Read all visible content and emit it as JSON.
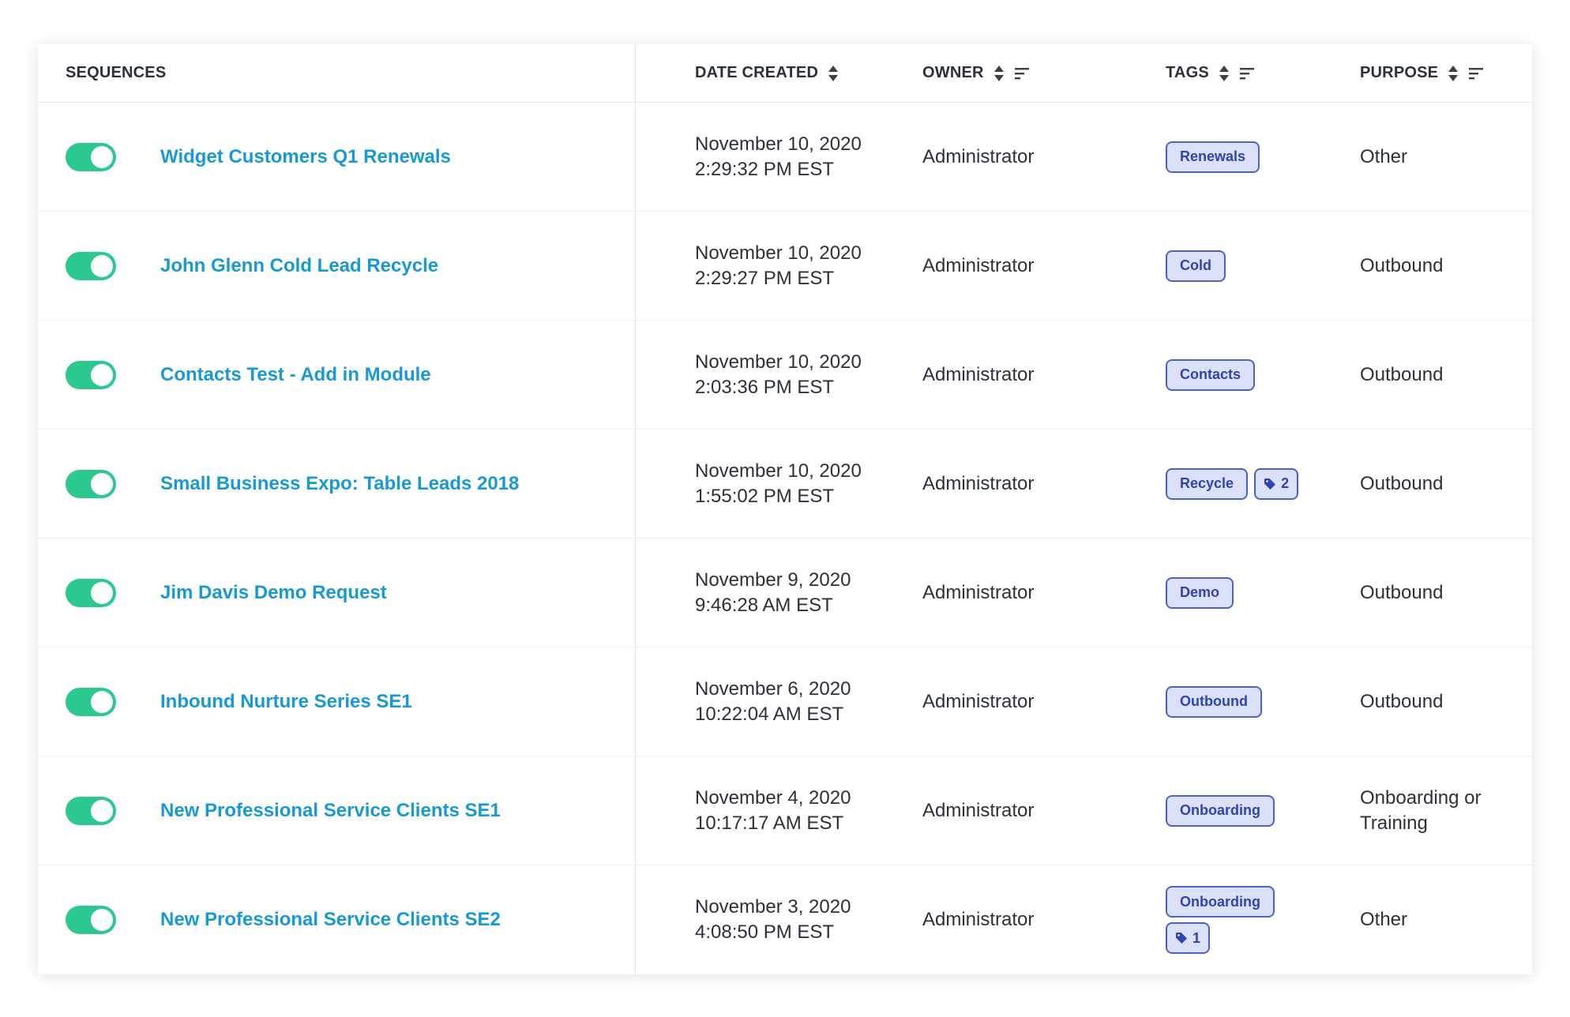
{
  "header": {
    "sequences": "SEQUENCES",
    "date_created": "DATE CREATED",
    "owner": "OWNER",
    "tags": "TAGS",
    "purpose": "PURPOSE"
  },
  "colors": {
    "toggle_on": "#2bc98e",
    "link": "#1899d6",
    "tag_bg": "#dbe1fb",
    "tag_border": "#4b62c8",
    "text": "#2b3138"
  },
  "rows": [
    {
      "enabled": true,
      "name": "Widget Customers Q1 Renewals",
      "date": "November 10, 2020",
      "time": "2:29:32 PM EST",
      "owner": "Administrator",
      "tags": [
        "Renewals"
      ],
      "extra_tags": null,
      "purpose": "Other"
    },
    {
      "enabled": true,
      "name": "John Glenn Cold Lead Recycle",
      "date": "November 10, 2020",
      "time": "2:29:27 PM EST",
      "owner": "Administrator",
      "tags": [
        "Cold"
      ],
      "extra_tags": null,
      "purpose": "Outbound"
    },
    {
      "enabled": true,
      "name": "Contacts Test - Add in Module",
      "date": "November 10, 2020",
      "time": "2:03:36 PM EST",
      "owner": "Administrator",
      "tags": [
        "Contacts"
      ],
      "extra_tags": null,
      "purpose": "Outbound"
    },
    {
      "enabled": true,
      "name": "Small Business Expo: Table Leads 2018",
      "date": "November 10, 2020",
      "time": "1:55:02 PM EST",
      "owner": "Administrator",
      "tags": [
        "Recycle"
      ],
      "extra_tags": "2",
      "purpose": "Outbound"
    },
    {
      "enabled": true,
      "name": "Jim Davis Demo Request",
      "date": "November 9, 2020",
      "time": "9:46:28 AM EST",
      "owner": "Administrator",
      "tags": [
        "Demo"
      ],
      "extra_tags": null,
      "purpose": "Outbound"
    },
    {
      "enabled": true,
      "name": "Inbound Nurture Series SE1",
      "date": "November 6, 2020",
      "time": "10:22:04 AM EST",
      "owner": "Administrator",
      "tags": [
        "Outbound"
      ],
      "extra_tags": null,
      "purpose": "Outbound"
    },
    {
      "enabled": true,
      "name": "New Professional Service Clients SE1",
      "date": "November 4, 2020",
      "time": "10:17:17 AM EST",
      "owner": "Administrator",
      "tags": [
        "Onboarding"
      ],
      "extra_tags": null,
      "purpose": "Onboarding or Training"
    },
    {
      "enabled": true,
      "name": "New Professional Service Clients SE2",
      "date": "November 3, 2020",
      "time": "4:08:50 PM EST",
      "owner": "Administrator",
      "tags": [
        "Onboarding"
      ],
      "extra_tags": "1",
      "purpose": "Other"
    }
  ]
}
